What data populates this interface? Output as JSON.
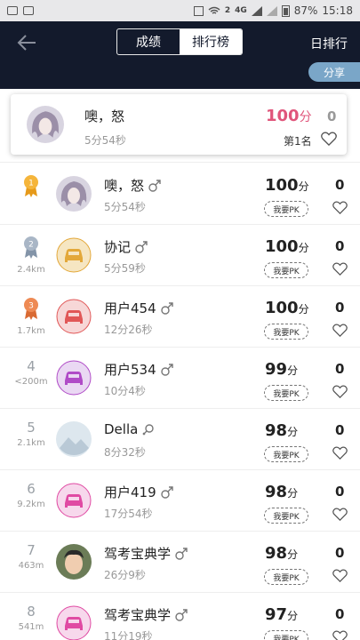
{
  "status_bar": {
    "battery": "87%",
    "time": "15:18",
    "network": "4G",
    "sim": "2"
  },
  "nav": {
    "tabs": [
      "成绩",
      "排行榜"
    ],
    "active_tab": 1,
    "right_label": "日排行"
  },
  "share_label": "分享",
  "my_entry": {
    "name": "噢，怒",
    "time": "5分54秒",
    "score": "100",
    "score_unit": "分",
    "rank": "第1名",
    "likes": "0"
  },
  "pk_label": "我要PK",
  "score_unit": "分",
  "rows": [
    {
      "rank": "1",
      "medal": "gold",
      "distance": "",
      "name": "噢，怒",
      "gender": "male",
      "time": "5分54秒",
      "score": "100",
      "likes": "0",
      "avatar": "anime"
    },
    {
      "rank": "2",
      "medal": "silver",
      "distance": "2.4km",
      "name": "协记",
      "gender": "male",
      "time": "5分59秒",
      "score": "100",
      "likes": "0",
      "avatar": "car-yellow"
    },
    {
      "rank": "3",
      "medal": "bronze",
      "distance": "1.7km",
      "name": "用户454",
      "gender": "male",
      "time": "12分26秒",
      "score": "100",
      "likes": "0",
      "avatar": "car-red"
    },
    {
      "rank": "4",
      "medal": "",
      "distance": "<200m",
      "name": "用户534",
      "gender": "male",
      "time": "10分4秒",
      "score": "99",
      "likes": "0",
      "avatar": "car-purple"
    },
    {
      "rank": "5",
      "medal": "",
      "distance": "2.1km",
      "name": "Della",
      "gender": "female",
      "time": "8分32秒",
      "score": "98",
      "likes": "0",
      "avatar": "photo"
    },
    {
      "rank": "6",
      "medal": "",
      "distance": "9.2km",
      "name": "用户419",
      "gender": "male",
      "time": "17分54秒",
      "score": "98",
      "likes": "0",
      "avatar": "car-pink"
    },
    {
      "rank": "7",
      "medal": "",
      "distance": "463m",
      "name": "驾考宝典学",
      "gender": "male",
      "time": "26分9秒",
      "score": "98",
      "likes": "0",
      "avatar": "child"
    },
    {
      "rank": "8",
      "medal": "",
      "distance": "541m",
      "name": "驾考宝典学",
      "gender": "male",
      "time": "11分19秒",
      "score": "97",
      "likes": "0",
      "avatar": "car-pink"
    }
  ]
}
